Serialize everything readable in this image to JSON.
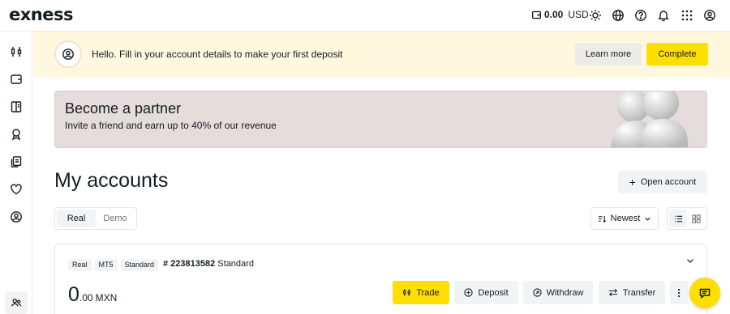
{
  "brand": {
    "logo_text": "exness"
  },
  "topbar": {
    "balance_amount": "0.00",
    "balance_currency": "USD",
    "icons": [
      "wallet-icon",
      "sun-icon",
      "globe-icon",
      "help-icon",
      "bell-icon",
      "apps-grid-icon",
      "profile-icon"
    ]
  },
  "sidebar": {
    "items": [
      "trade-icon",
      "wallet-icon",
      "document-icon",
      "award-icon",
      "copy-icon",
      "heart-icon",
      "profile-icon"
    ],
    "bottom_item": "partner-users-icon"
  },
  "notice": {
    "text": "Hello. Fill in your account details to make your first deposit",
    "learn_more_label": "Learn more",
    "complete_label": "Complete"
  },
  "partner": {
    "title": "Become a partner",
    "subtitle": "Invite a friend and earn up to 40% of our revenue"
  },
  "accounts": {
    "heading": "My accounts",
    "open_account_label": "Open account",
    "tabs": [
      "Real",
      "Demo"
    ],
    "active_tab": "Real",
    "sort_label": "Newest",
    "view_modes": [
      "list-view-icon",
      "grid-view-icon"
    ]
  },
  "account_card": {
    "tags": [
      "Real",
      "MT5",
      "Standard"
    ],
    "number": "# 223813582",
    "type": "Standard",
    "balance_int": "0",
    "balance_dec": ".00",
    "balance_currency": "MXN",
    "actions": {
      "trade": "Trade",
      "deposit": "Deposit",
      "withdraw": "Withdraw",
      "transfer": "Transfer"
    }
  },
  "colors": {
    "accent": "#ffde02",
    "notice_bg": "#fff7de",
    "partner_bg": "#e5dcdc",
    "text": "#141d22"
  }
}
